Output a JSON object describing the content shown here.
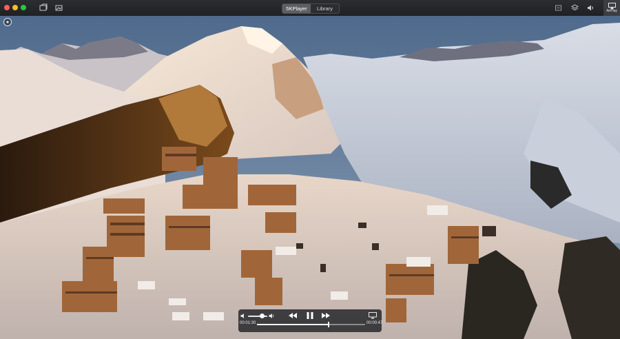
{
  "titlebar": {
    "tabs": [
      {
        "label": "5KPlayer",
        "active": true
      },
      {
        "label": "Library",
        "active": false
      }
    ],
    "left_icons": [
      "video-folder-icon",
      "photo-folder-icon"
    ],
    "right_icons": [
      "dlna-icon",
      "layers-icon",
      "volume-icon"
    ],
    "airplay_label": "AirPlay"
  },
  "player": {
    "elapsed": "00:01:30",
    "remaining": "00:00:47",
    "progress": 0.66,
    "volume": 0.7,
    "buttons": [
      "rewind-icon",
      "pause-icon",
      "fast-forward-icon",
      "screen-icon"
    ]
  },
  "colors": {
    "tab_active": "#5c5f64",
    "titlebar": "#2b2d31",
    "sky_top": "#4f6a8c",
    "snow_lit": "#f3e2cf"
  }
}
